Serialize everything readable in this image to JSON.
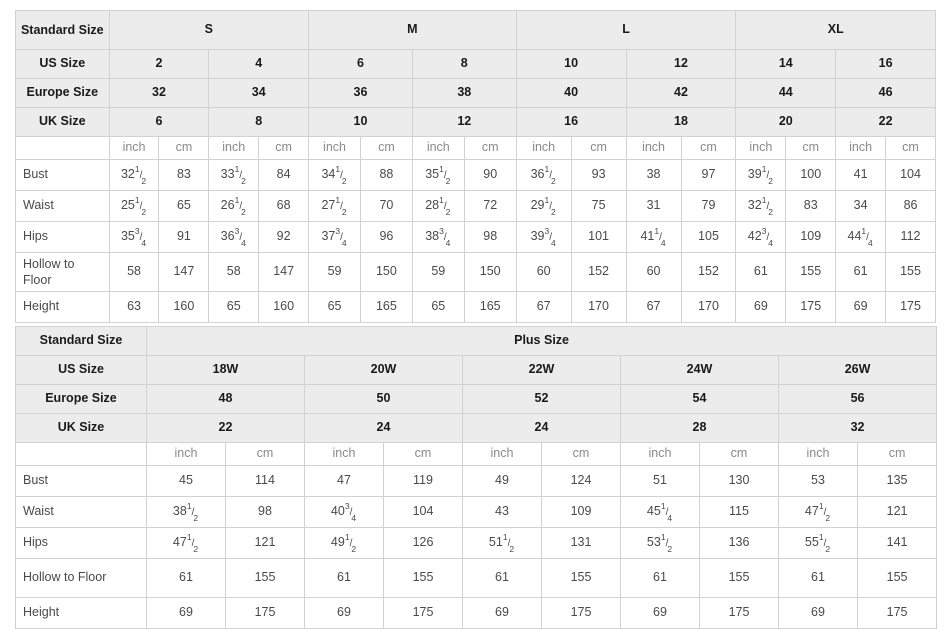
{
  "standard_table": {
    "row_header_labels": {
      "standard_size": "Standard Size",
      "us_size": "US Size",
      "europe_size": "Europe Size",
      "uk_size": "UK Size"
    },
    "size_groups": [
      "S",
      "M",
      "L",
      "XL"
    ],
    "us_sizes": [
      "2",
      "4",
      "6",
      "8",
      "10",
      "12",
      "14",
      "16"
    ],
    "europe_sizes": [
      "32",
      "34",
      "36",
      "38",
      "40",
      "42",
      "44",
      "46"
    ],
    "uk_sizes": [
      "6",
      "8",
      "10",
      "12",
      "16",
      "18",
      "20",
      "22"
    ],
    "unit_labels": [
      "inch",
      "cm",
      "inch",
      "cm",
      "inch",
      "cm",
      "inch",
      "cm",
      "inch",
      "cm",
      "inch",
      "cm",
      "inch",
      "cm",
      "inch",
      "cm"
    ],
    "measurements": [
      {
        "label": "Bust",
        "values": [
          {
            "whole": "32",
            "num": "1",
            "den": "2"
          },
          {
            "whole": "83"
          },
          {
            "whole": "33",
            "num": "1",
            "den": "2"
          },
          {
            "whole": "84"
          },
          {
            "whole": "34",
            "num": "1",
            "den": "2"
          },
          {
            "whole": "88"
          },
          {
            "whole": "35",
            "num": "1",
            "den": "2"
          },
          {
            "whole": "90"
          },
          {
            "whole": "36",
            "num": "1",
            "den": "2"
          },
          {
            "whole": "93"
          },
          {
            "whole": "38"
          },
          {
            "whole": "97"
          },
          {
            "whole": "39",
            "num": "1",
            "den": "2"
          },
          {
            "whole": "100"
          },
          {
            "whole": "41"
          },
          {
            "whole": "104"
          }
        ]
      },
      {
        "label": "Waist",
        "values": [
          {
            "whole": "25",
            "num": "1",
            "den": "2"
          },
          {
            "whole": "65"
          },
          {
            "whole": "26",
            "num": "1",
            "den": "2"
          },
          {
            "whole": "68"
          },
          {
            "whole": "27",
            "num": "1",
            "den": "2"
          },
          {
            "whole": "70"
          },
          {
            "whole": "28",
            "num": "1",
            "den": "2"
          },
          {
            "whole": "72"
          },
          {
            "whole": "29",
            "num": "1",
            "den": "2"
          },
          {
            "whole": "75"
          },
          {
            "whole": "31"
          },
          {
            "whole": "79"
          },
          {
            "whole": "32",
            "num": "1",
            "den": "2"
          },
          {
            "whole": "83"
          },
          {
            "whole": "34"
          },
          {
            "whole": "86"
          }
        ]
      },
      {
        "label": "Hips",
        "values": [
          {
            "whole": "35",
            "num": "3",
            "den": "4"
          },
          {
            "whole": "91"
          },
          {
            "whole": "36",
            "num": "3",
            "den": "4"
          },
          {
            "whole": "92"
          },
          {
            "whole": "37",
            "num": "3",
            "den": "4"
          },
          {
            "whole": "96"
          },
          {
            "whole": "38",
            "num": "3",
            "den": "4"
          },
          {
            "whole": "98"
          },
          {
            "whole": "39",
            "num": "3",
            "den": "4"
          },
          {
            "whole": "101"
          },
          {
            "whole": "41",
            "num": "1",
            "den": "4"
          },
          {
            "whole": "105"
          },
          {
            "whole": "42",
            "num": "3",
            "den": "4"
          },
          {
            "whole": "109"
          },
          {
            "whole": "44",
            "num": "1",
            "den": "4"
          },
          {
            "whole": "112"
          }
        ]
      },
      {
        "label": "Hollow to Floor",
        "values": [
          {
            "whole": "58"
          },
          {
            "whole": "147"
          },
          {
            "whole": "58"
          },
          {
            "whole": "147"
          },
          {
            "whole": "59"
          },
          {
            "whole": "150"
          },
          {
            "whole": "59"
          },
          {
            "whole": "150"
          },
          {
            "whole": "60"
          },
          {
            "whole": "152"
          },
          {
            "whole": "60"
          },
          {
            "whole": "152"
          },
          {
            "whole": "61"
          },
          {
            "whole": "155"
          },
          {
            "whole": "61"
          },
          {
            "whole": "155"
          }
        ]
      },
      {
        "label": "Height",
        "values": [
          {
            "whole": "63"
          },
          {
            "whole": "160"
          },
          {
            "whole": "65"
          },
          {
            "whole": "160"
          },
          {
            "whole": "65"
          },
          {
            "whole": "165"
          },
          {
            "whole": "65"
          },
          {
            "whole": "165"
          },
          {
            "whole": "67"
          },
          {
            "whole": "170"
          },
          {
            "whole": "67"
          },
          {
            "whole": "170"
          },
          {
            "whole": "69"
          },
          {
            "whole": "175"
          },
          {
            "whole": "69"
          },
          {
            "whole": "175"
          }
        ]
      }
    ]
  },
  "plus_table": {
    "row_header_labels": {
      "standard_size": "Standard Size",
      "us_size": "US Size",
      "europe_size": "Europe Size",
      "uk_size": "UK Size"
    },
    "group_title": "Plus Size",
    "us_sizes": [
      "18W",
      "20W",
      "22W",
      "24W",
      "26W"
    ],
    "europe_sizes": [
      "48",
      "50",
      "52",
      "54",
      "56"
    ],
    "uk_sizes": [
      "22",
      "24",
      "24",
      "28",
      "32"
    ],
    "unit_labels": [
      "inch",
      "cm",
      "inch",
      "cm",
      "inch",
      "cm",
      "inch",
      "cm",
      "inch",
      "cm"
    ],
    "measurements": [
      {
        "label": "Bust",
        "values": [
          {
            "whole": "45"
          },
          {
            "whole": "114"
          },
          {
            "whole": "47"
          },
          {
            "whole": "119"
          },
          {
            "whole": "49"
          },
          {
            "whole": "124"
          },
          {
            "whole": "51"
          },
          {
            "whole": "130"
          },
          {
            "whole": "53"
          },
          {
            "whole": "135"
          }
        ]
      },
      {
        "label": "Waist",
        "values": [
          {
            "whole": "38",
            "num": "1",
            "den": "2"
          },
          {
            "whole": "98"
          },
          {
            "whole": "40",
            "num": "3",
            "den": "4"
          },
          {
            "whole": "104"
          },
          {
            "whole": "43"
          },
          {
            "whole": "109"
          },
          {
            "whole": "45",
            "num": "1",
            "den": "4"
          },
          {
            "whole": "115"
          },
          {
            "whole": "47",
            "num": "1",
            "den": "2"
          },
          {
            "whole": "121"
          }
        ]
      },
      {
        "label": "Hips",
        "values": [
          {
            "whole": "47",
            "num": "1",
            "den": "2"
          },
          {
            "whole": "121"
          },
          {
            "whole": "49",
            "num": "1",
            "den": "2"
          },
          {
            "whole": "126"
          },
          {
            "whole": "51",
            "num": "1",
            "den": "2"
          },
          {
            "whole": "131"
          },
          {
            "whole": "53",
            "num": "1",
            "den": "2"
          },
          {
            "whole": "136"
          },
          {
            "whole": "55",
            "num": "1",
            "den": "2"
          },
          {
            "whole": "141"
          }
        ]
      },
      {
        "label": "Hollow to Floor",
        "values": [
          {
            "whole": "61"
          },
          {
            "whole": "155"
          },
          {
            "whole": "61"
          },
          {
            "whole": "155"
          },
          {
            "whole": "61"
          },
          {
            "whole": "155"
          },
          {
            "whole": "61"
          },
          {
            "whole": "155"
          },
          {
            "whole": "61"
          },
          {
            "whole": "155"
          }
        ]
      },
      {
        "label": "Height",
        "values": [
          {
            "whole": "69"
          },
          {
            "whole": "175"
          },
          {
            "whole": "69"
          },
          {
            "whole": "175"
          },
          {
            "whole": "69"
          },
          {
            "whole": "175"
          },
          {
            "whole": "69"
          },
          {
            "whole": "175"
          },
          {
            "whole": "69"
          },
          {
            "whole": "175"
          }
        ]
      }
    ]
  },
  "colors": {
    "header_bg": "#ececec",
    "border": "#d2d2d2",
    "text": "#4a4a4a",
    "header_text": "#1a1a1a",
    "unit_text": "#8a8a8a"
  }
}
